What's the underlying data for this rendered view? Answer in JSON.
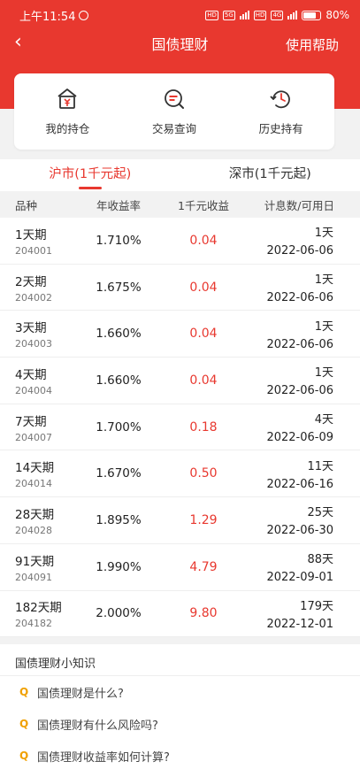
{
  "status": {
    "time": "上午11:54",
    "battery": "80%",
    "net1": "5G",
    "net2": "4G",
    "hd": "HD"
  },
  "header": {
    "back": "‹",
    "title": "国债理财",
    "help": "使用帮助"
  },
  "quick": [
    {
      "label": "我的持仓",
      "icon": "wallet-yuan-icon"
    },
    {
      "label": "交易查询",
      "icon": "search-coin-icon"
    },
    {
      "label": "历史持有",
      "icon": "history-clock-icon"
    }
  ],
  "tabs": [
    {
      "label": "沪市(1千元起)",
      "active": true
    },
    {
      "label": "深市(1千元起)",
      "active": false
    }
  ],
  "table": {
    "headers": [
      "品种",
      "年收益率",
      "1千元收益",
      "计息数/可用日"
    ],
    "rows": [
      {
        "name": "1天期",
        "code": "204001",
        "rate": "1.710%",
        "earn": "0.04",
        "days": "1天",
        "date": "2022-06-06"
      },
      {
        "name": "2天期",
        "code": "204002",
        "rate": "1.675%",
        "earn": "0.04",
        "days": "1天",
        "date": "2022-06-06"
      },
      {
        "name": "3天期",
        "code": "204003",
        "rate": "1.660%",
        "earn": "0.04",
        "days": "1天",
        "date": "2022-06-06"
      },
      {
        "name": "4天期",
        "code": "204004",
        "rate": "1.660%",
        "earn": "0.04",
        "days": "1天",
        "date": "2022-06-06"
      },
      {
        "name": "7天期",
        "code": "204007",
        "rate": "1.700%",
        "earn": "0.18",
        "days": "4天",
        "date": "2022-06-09"
      },
      {
        "name": "14天期",
        "code": "204014",
        "rate": "1.670%",
        "earn": "0.50",
        "days": "11天",
        "date": "2022-06-16"
      },
      {
        "name": "28天期",
        "code": "204028",
        "rate": "1.895%",
        "earn": "1.29",
        "days": "25天",
        "date": "2022-06-30"
      },
      {
        "name": "91天期",
        "code": "204091",
        "rate": "1.990%",
        "earn": "4.79",
        "days": "88天",
        "date": "2022-09-01"
      },
      {
        "name": "182天期",
        "code": "204182",
        "rate": "2.000%",
        "earn": "9.80",
        "days": "179天",
        "date": "2022-12-01"
      }
    ]
  },
  "knowledge": {
    "title": "国债理财小知识",
    "mark": "Q",
    "items": [
      "国债理财是什么?",
      "国债理财有什么风险吗?",
      "国债理财收益率如何计算?"
    ]
  },
  "colors": {
    "brand": "#e8382f",
    "accent": "#f0a000"
  }
}
